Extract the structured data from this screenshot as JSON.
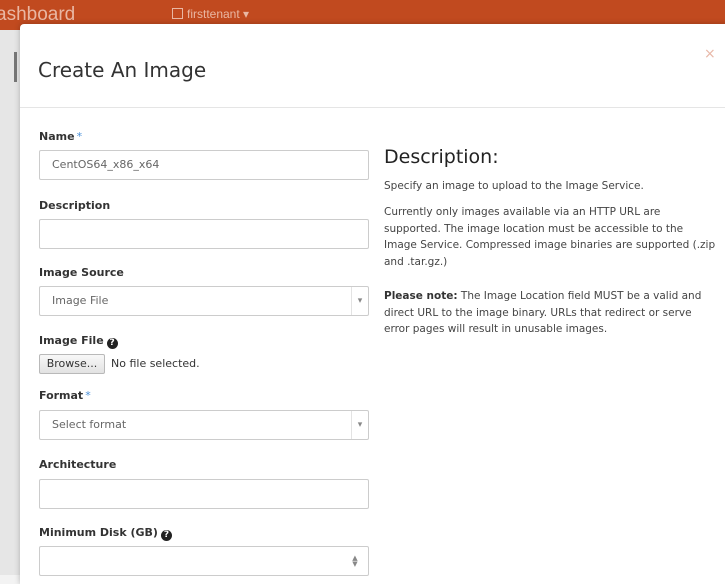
{
  "background": {
    "brand": "ashboard",
    "project": "firsttenant"
  },
  "modal": {
    "title": "Create An Image",
    "close": "×"
  },
  "form": {
    "name": {
      "label": "Name",
      "required": "*",
      "value": "CentOS64_x86_x64"
    },
    "description": {
      "label": "Description",
      "value": ""
    },
    "image_source": {
      "label": "Image Source",
      "selected": "Image File"
    },
    "image_file": {
      "label": "Image File",
      "browse_label": "Browse...",
      "status": "No file selected."
    },
    "format": {
      "label": "Format",
      "required": "*",
      "selected": "Select format"
    },
    "architecture": {
      "label": "Architecture",
      "value": ""
    },
    "minimum_disk": {
      "label": "Minimum Disk (GB)",
      "value": ""
    }
  },
  "help": {
    "title": "Description:",
    "para1": "Specify an image to upload to the Image Service.",
    "para2": "Currently only images available via an HTTP URL are supported. The image location must be accessible to the Image Service. Compressed image binaries are supported (.zip and .tar.gz.)",
    "note_label": "Please note:",
    "note_text": " The Image Location field MUST be a valid and direct URL to the image binary. URLs that redirect or serve error pages will result in unusable images."
  },
  "colors": {
    "topbar": "#c14a1f",
    "required_marker": "#4a90d9"
  },
  "icons": [
    "help-icon",
    "close-icon",
    "chevron-down-icon",
    "project-icon",
    "spinner-icon"
  ]
}
